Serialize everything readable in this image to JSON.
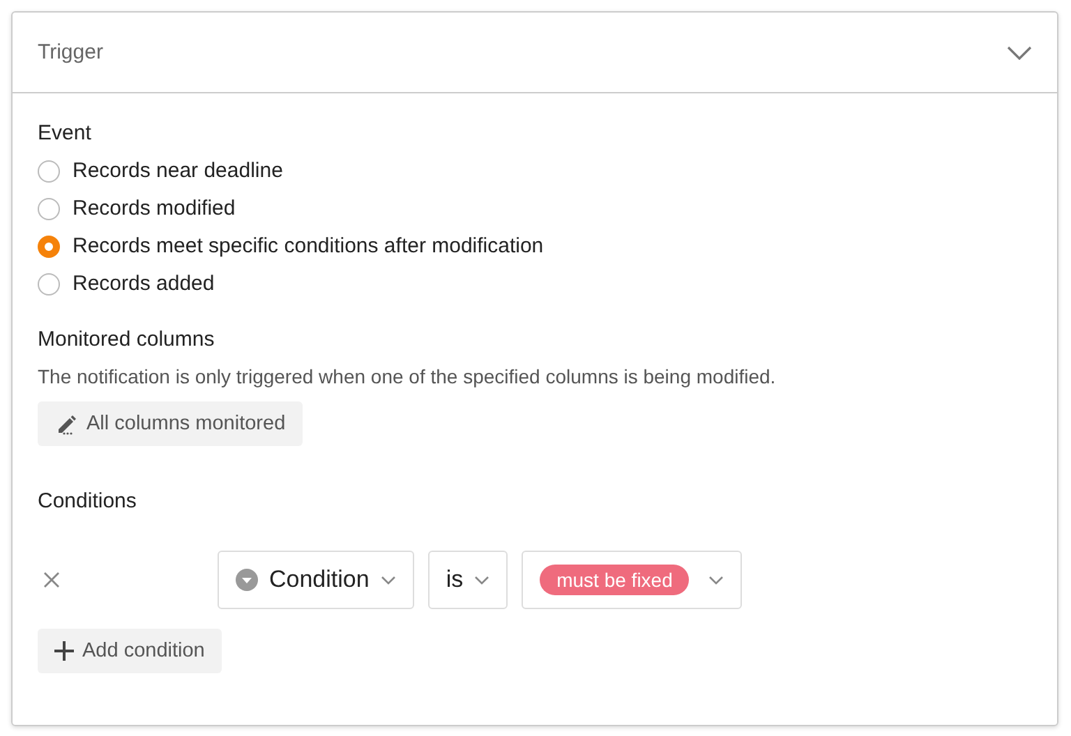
{
  "panel": {
    "title": "Trigger",
    "expanded": true
  },
  "event": {
    "label": "Event",
    "options": [
      {
        "label": "Records near deadline",
        "selected": false
      },
      {
        "label": "Records modified",
        "selected": false
      },
      {
        "label": "Records meet specific conditions after modification",
        "selected": true
      },
      {
        "label": "Records added",
        "selected": false
      }
    ]
  },
  "monitored_columns": {
    "label": "Monitored columns",
    "description": "The notification is only triggered when one of the specified columns is being modified.",
    "button": "All columns monitored"
  },
  "conditions": {
    "label": "Conditions",
    "rows": [
      {
        "column": "Condition",
        "operator": "is",
        "value": "must be fixed"
      }
    ],
    "add_button": "Add condition"
  }
}
